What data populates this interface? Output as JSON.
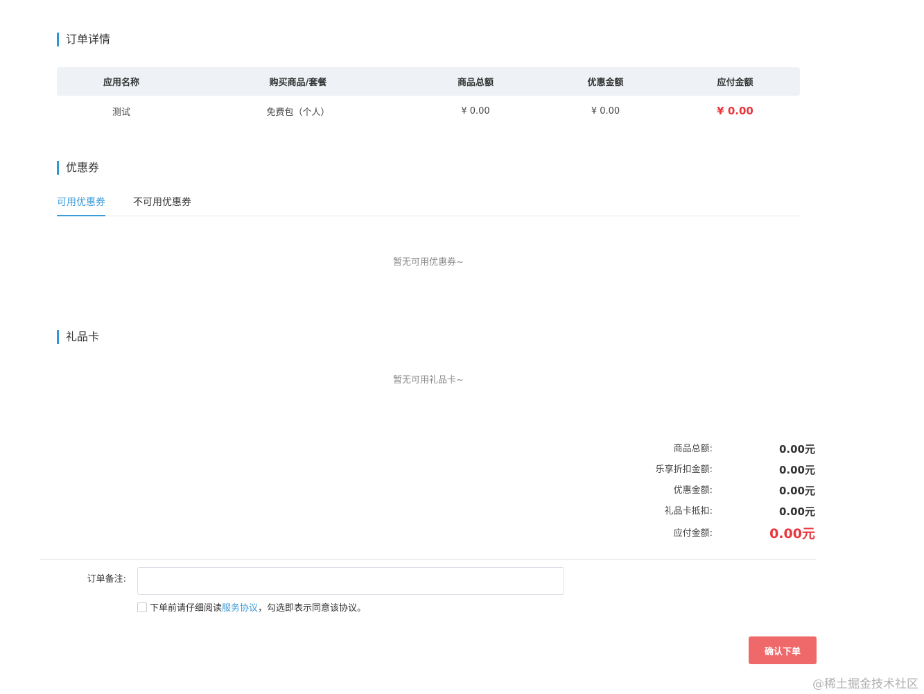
{
  "order_details": {
    "title": "订单详情",
    "headers": [
      "应用名称",
      "购买商品/套餐",
      "商品总额",
      "优惠金额",
      "应付金额"
    ],
    "row": {
      "app_name": "测试",
      "package": "免费包（个人）",
      "total": "¥ 0.00",
      "discount": "¥ 0.00",
      "payable": "¥ 0.00"
    }
  },
  "coupons": {
    "title": "优惠券",
    "tabs": [
      {
        "label": "可用优惠券",
        "active": true
      },
      {
        "label": "不可用优惠券",
        "active": false
      }
    ],
    "empty_text": "暂无可用优惠券~"
  },
  "gift_cards": {
    "title": "礼品卡",
    "empty_text": "暂无可用礼品卡~"
  },
  "summary": {
    "rows": [
      {
        "label": "商品总额:",
        "value": "0.00元"
      },
      {
        "label": "乐享折扣金额:",
        "value": "0.00元"
      },
      {
        "label": "优惠金额:",
        "value": "0.00元"
      },
      {
        "label": "礼品卡抵扣:",
        "value": "0.00元"
      },
      {
        "label": "应付金额:",
        "value": "0.00元"
      }
    ]
  },
  "remark": {
    "label": "订单备注:",
    "value": "",
    "placeholder": ""
  },
  "agreement": {
    "checked": false,
    "prefix": "下单前请仔细阅读",
    "link": "服务协议",
    "suffix": "，勾选即表示同意该协议。"
  },
  "confirm_button": "确认下单",
  "watermark": "@稀土掘金技术社区",
  "colors": {
    "accent": "#3a9ad9",
    "price_red": "#e8363c",
    "button_bg": "#f0696a",
    "header_bg": "#eef2f6"
  }
}
